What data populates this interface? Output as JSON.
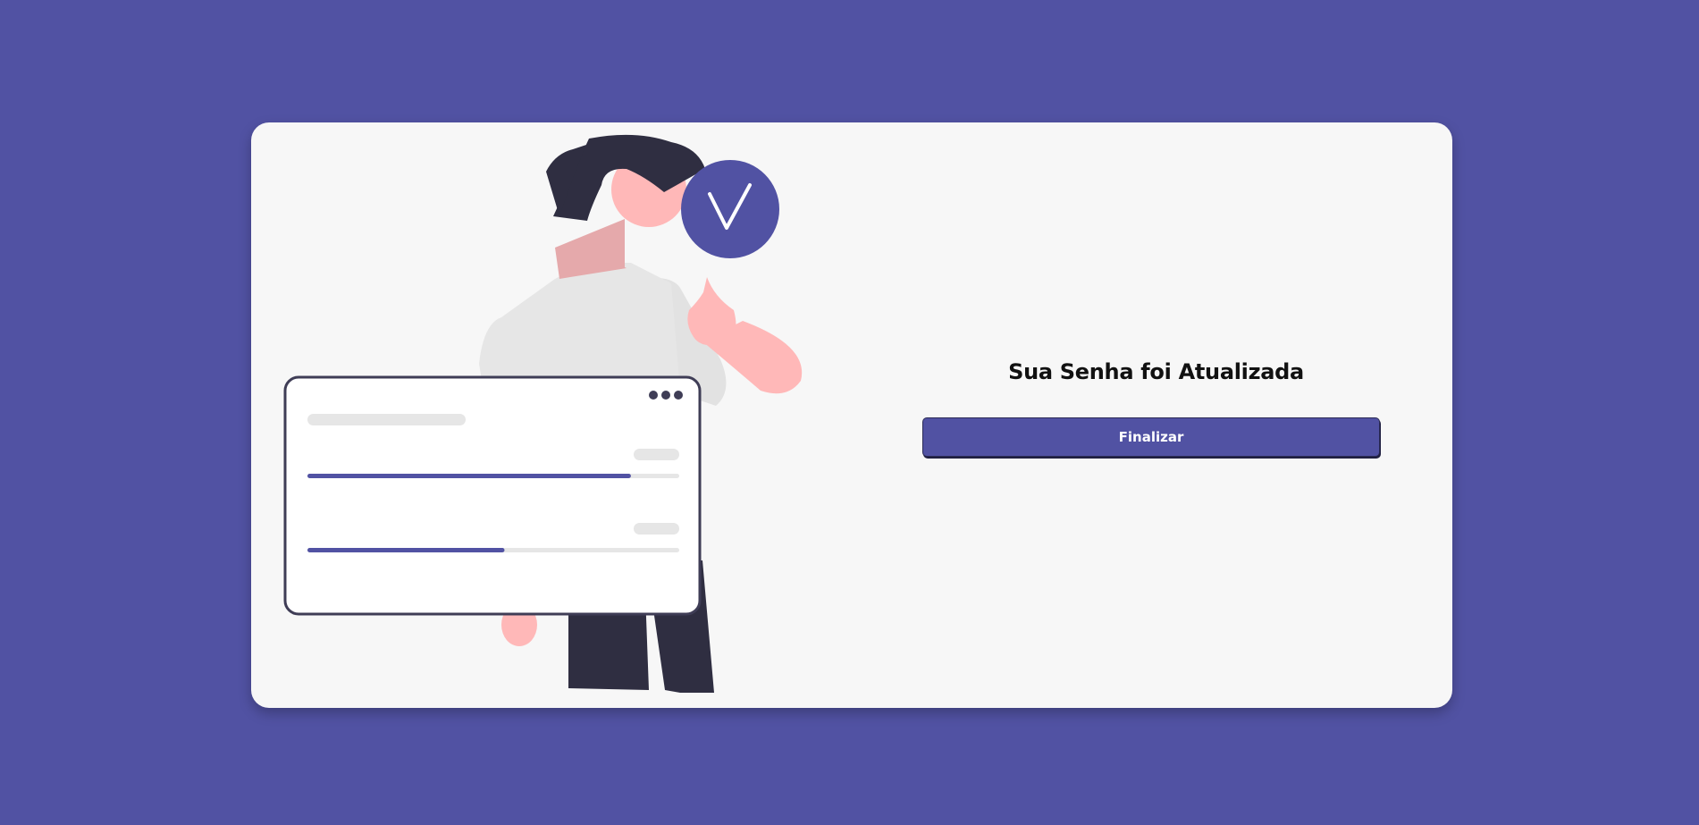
{
  "main": {
    "title": "Sua Senha foi Atualizada",
    "finalize_label": "Finalizar"
  },
  "illustration": {
    "progress_bars": [
      0.87,
      0.53
    ]
  },
  "colors": {
    "background": "#5152a3",
    "card": "#f7f7f7",
    "accent": "#5152a3",
    "title_text": "#111111"
  },
  "icons": [
    "check-icon",
    "more-dots-icon"
  ]
}
